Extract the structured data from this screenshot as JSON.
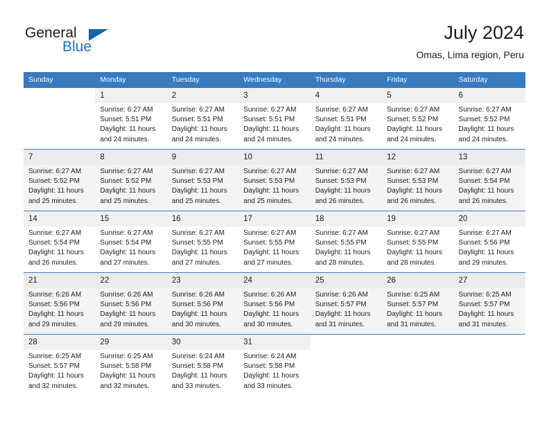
{
  "brand": {
    "name_part1": "General",
    "name_part2": "Blue",
    "triangle_icon": "triangle-icon"
  },
  "header": {
    "title": "July 2024",
    "location": "Omas, Lima region, Peru"
  },
  "theme": {
    "header_blue": "#3a7bbf",
    "brand_blue": "#1a72c4",
    "row_shade": "#f4f4f4",
    "daynum_shade": "#f0f0f0"
  },
  "weekdays": [
    "Sunday",
    "Monday",
    "Tuesday",
    "Wednesday",
    "Thursday",
    "Friday",
    "Saturday"
  ],
  "labels": {
    "sunrise": "Sunrise:",
    "sunset": "Sunset:",
    "daylight": "Daylight:"
  },
  "weeks": [
    [
      {
        "day": "",
        "sunrise": "",
        "sunset": "",
        "daylight_line1": "",
        "daylight_line2": ""
      },
      {
        "day": "1",
        "sunrise": "Sunrise: 6:27 AM",
        "sunset": "Sunset: 5:51 PM",
        "daylight_line1": "Daylight: 11 hours",
        "daylight_line2": "and 24 minutes."
      },
      {
        "day": "2",
        "sunrise": "Sunrise: 6:27 AM",
        "sunset": "Sunset: 5:51 PM",
        "daylight_line1": "Daylight: 11 hours",
        "daylight_line2": "and 24 minutes."
      },
      {
        "day": "3",
        "sunrise": "Sunrise: 6:27 AM",
        "sunset": "Sunset: 5:51 PM",
        "daylight_line1": "Daylight: 11 hours",
        "daylight_line2": "and 24 minutes."
      },
      {
        "day": "4",
        "sunrise": "Sunrise: 6:27 AM",
        "sunset": "Sunset: 5:51 PM",
        "daylight_line1": "Daylight: 11 hours",
        "daylight_line2": "and 24 minutes."
      },
      {
        "day": "5",
        "sunrise": "Sunrise: 6:27 AM",
        "sunset": "Sunset: 5:52 PM",
        "daylight_line1": "Daylight: 11 hours",
        "daylight_line2": "and 24 minutes."
      },
      {
        "day": "6",
        "sunrise": "Sunrise: 6:27 AM",
        "sunset": "Sunset: 5:52 PM",
        "daylight_line1": "Daylight: 11 hours",
        "daylight_line2": "and 24 minutes."
      }
    ],
    [
      {
        "day": "7",
        "sunrise": "Sunrise: 6:27 AM",
        "sunset": "Sunset: 5:52 PM",
        "daylight_line1": "Daylight: 11 hours",
        "daylight_line2": "and 25 minutes."
      },
      {
        "day": "8",
        "sunrise": "Sunrise: 6:27 AM",
        "sunset": "Sunset: 5:52 PM",
        "daylight_line1": "Daylight: 11 hours",
        "daylight_line2": "and 25 minutes."
      },
      {
        "day": "9",
        "sunrise": "Sunrise: 6:27 AM",
        "sunset": "Sunset: 5:53 PM",
        "daylight_line1": "Daylight: 11 hours",
        "daylight_line2": "and 25 minutes."
      },
      {
        "day": "10",
        "sunrise": "Sunrise: 6:27 AM",
        "sunset": "Sunset: 5:53 PM",
        "daylight_line1": "Daylight: 11 hours",
        "daylight_line2": "and 25 minutes."
      },
      {
        "day": "11",
        "sunrise": "Sunrise: 6:27 AM",
        "sunset": "Sunset: 5:53 PM",
        "daylight_line1": "Daylight: 11 hours",
        "daylight_line2": "and 26 minutes."
      },
      {
        "day": "12",
        "sunrise": "Sunrise: 6:27 AM",
        "sunset": "Sunset: 5:53 PM",
        "daylight_line1": "Daylight: 11 hours",
        "daylight_line2": "and 26 minutes."
      },
      {
        "day": "13",
        "sunrise": "Sunrise: 6:27 AM",
        "sunset": "Sunset: 5:54 PM",
        "daylight_line1": "Daylight: 11 hours",
        "daylight_line2": "and 26 minutes."
      }
    ],
    [
      {
        "day": "14",
        "sunrise": "Sunrise: 6:27 AM",
        "sunset": "Sunset: 5:54 PM",
        "daylight_line1": "Daylight: 11 hours",
        "daylight_line2": "and 26 minutes."
      },
      {
        "day": "15",
        "sunrise": "Sunrise: 6:27 AM",
        "sunset": "Sunset: 5:54 PM",
        "daylight_line1": "Daylight: 11 hours",
        "daylight_line2": "and 27 minutes."
      },
      {
        "day": "16",
        "sunrise": "Sunrise: 6:27 AM",
        "sunset": "Sunset: 5:55 PM",
        "daylight_line1": "Daylight: 11 hours",
        "daylight_line2": "and 27 minutes."
      },
      {
        "day": "17",
        "sunrise": "Sunrise: 6:27 AM",
        "sunset": "Sunset: 5:55 PM",
        "daylight_line1": "Daylight: 11 hours",
        "daylight_line2": "and 27 minutes."
      },
      {
        "day": "18",
        "sunrise": "Sunrise: 6:27 AM",
        "sunset": "Sunset: 5:55 PM",
        "daylight_line1": "Daylight: 11 hours",
        "daylight_line2": "and 28 minutes."
      },
      {
        "day": "19",
        "sunrise": "Sunrise: 6:27 AM",
        "sunset": "Sunset: 5:55 PM",
        "daylight_line1": "Daylight: 11 hours",
        "daylight_line2": "and 28 minutes."
      },
      {
        "day": "20",
        "sunrise": "Sunrise: 6:27 AM",
        "sunset": "Sunset: 5:56 PM",
        "daylight_line1": "Daylight: 11 hours",
        "daylight_line2": "and 29 minutes."
      }
    ],
    [
      {
        "day": "21",
        "sunrise": "Sunrise: 6:26 AM",
        "sunset": "Sunset: 5:56 PM",
        "daylight_line1": "Daylight: 11 hours",
        "daylight_line2": "and 29 minutes."
      },
      {
        "day": "22",
        "sunrise": "Sunrise: 6:26 AM",
        "sunset": "Sunset: 5:56 PM",
        "daylight_line1": "Daylight: 11 hours",
        "daylight_line2": "and 29 minutes."
      },
      {
        "day": "23",
        "sunrise": "Sunrise: 6:26 AM",
        "sunset": "Sunset: 5:56 PM",
        "daylight_line1": "Daylight: 11 hours",
        "daylight_line2": "and 30 minutes."
      },
      {
        "day": "24",
        "sunrise": "Sunrise: 6:26 AM",
        "sunset": "Sunset: 5:56 PM",
        "daylight_line1": "Daylight: 11 hours",
        "daylight_line2": "and 30 minutes."
      },
      {
        "day": "25",
        "sunrise": "Sunrise: 6:26 AM",
        "sunset": "Sunset: 5:57 PM",
        "daylight_line1": "Daylight: 11 hours",
        "daylight_line2": "and 31 minutes."
      },
      {
        "day": "26",
        "sunrise": "Sunrise: 6:25 AM",
        "sunset": "Sunset: 5:57 PM",
        "daylight_line1": "Daylight: 11 hours",
        "daylight_line2": "and 31 minutes."
      },
      {
        "day": "27",
        "sunrise": "Sunrise: 6:25 AM",
        "sunset": "Sunset: 5:57 PM",
        "daylight_line1": "Daylight: 11 hours",
        "daylight_line2": "and 31 minutes."
      }
    ],
    [
      {
        "day": "28",
        "sunrise": "Sunrise: 6:25 AM",
        "sunset": "Sunset: 5:57 PM",
        "daylight_line1": "Daylight: 11 hours",
        "daylight_line2": "and 32 minutes."
      },
      {
        "day": "29",
        "sunrise": "Sunrise: 6:25 AM",
        "sunset": "Sunset: 5:58 PM",
        "daylight_line1": "Daylight: 11 hours",
        "daylight_line2": "and 32 minutes."
      },
      {
        "day": "30",
        "sunrise": "Sunrise: 6:24 AM",
        "sunset": "Sunset: 5:58 PM",
        "daylight_line1": "Daylight: 11 hours",
        "daylight_line2": "and 33 minutes."
      },
      {
        "day": "31",
        "sunrise": "Sunrise: 6:24 AM",
        "sunset": "Sunset: 5:58 PM",
        "daylight_line1": "Daylight: 11 hours",
        "daylight_line2": "and 33 minutes."
      },
      {
        "day": "",
        "sunrise": "",
        "sunset": "",
        "daylight_line1": "",
        "daylight_line2": ""
      },
      {
        "day": "",
        "sunrise": "",
        "sunset": "",
        "daylight_line1": "",
        "daylight_line2": ""
      },
      {
        "day": "",
        "sunrise": "",
        "sunset": "",
        "daylight_line1": "",
        "daylight_line2": ""
      }
    ]
  ]
}
